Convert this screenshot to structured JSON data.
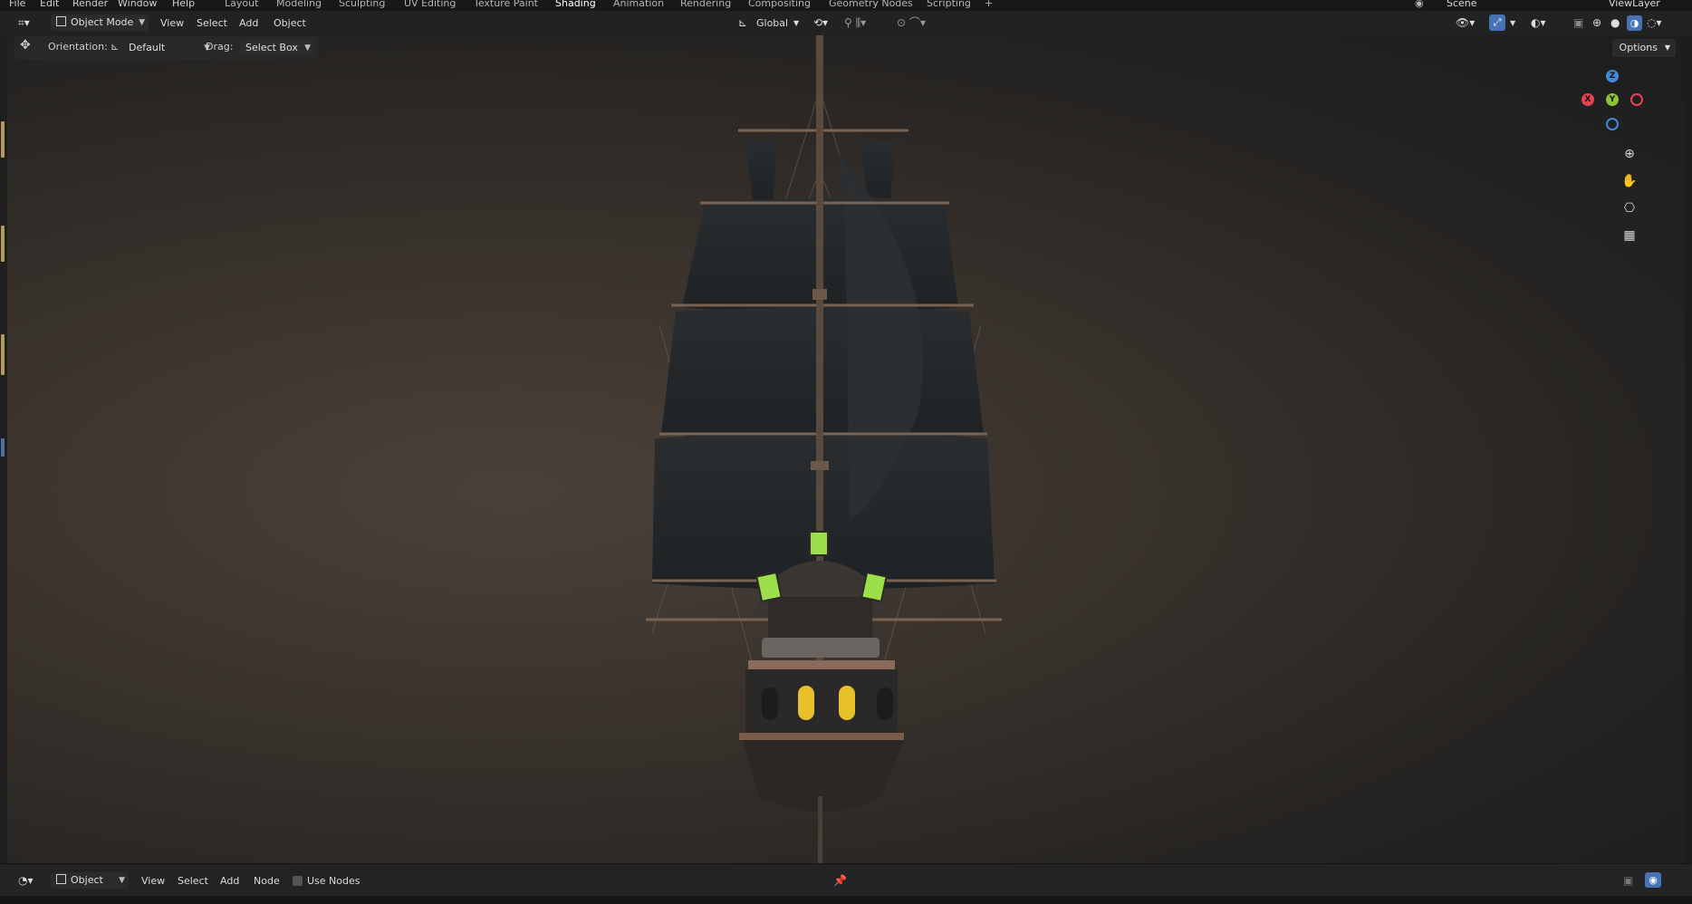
{
  "menu": {
    "file": "File",
    "edit": "Edit",
    "render": "Render",
    "window": "Window",
    "help": "Help"
  },
  "workspaces": [
    "Layout",
    "Modeling",
    "Sculpting",
    "UV Editing",
    "Texture Paint",
    "Shading",
    "Animation",
    "Rendering",
    "Compositing",
    "Geometry Nodes",
    "Scripting"
  ],
  "active_workspace": "Shading",
  "scene": {
    "name": "Scene",
    "view_layer": "ViewLayer"
  },
  "header": {
    "mode": "Object Mode",
    "view": "View",
    "select": "Select",
    "add": "Add",
    "object": "Object",
    "transform_orientation": "Global"
  },
  "tool_settings": {
    "orientation_label": "Orientation:",
    "orientation_value": "Default",
    "drag_label": "Drag:",
    "drag_value": "Select Box",
    "options": "Options"
  },
  "gizmo": {
    "x": "X",
    "y": "Y",
    "z": "Z"
  },
  "node_editor_header": {
    "mode": "Object",
    "view": "View",
    "select": "Select",
    "add": "Add",
    "node": "Node",
    "use_nodes": "Use Nodes"
  },
  "colors": {
    "x_axis": "#e5434f",
    "y_axis": "#8bc43b",
    "z_axis": "#3f8ad8",
    "active_toggle": "#4772b3",
    "lantern_green": "#9be04a",
    "window_yellow": "#e8c12a"
  },
  "icons": [
    "editor-type-icon",
    "move-icon",
    "orientation-icon",
    "pivot-icon",
    "snap-icon",
    "proportional-icon",
    "overlay-icon",
    "xray-icon",
    "wireframe-shading-icon",
    "solid-shading-icon",
    "material-shading-icon",
    "rendered-shading-icon",
    "zoom-icon",
    "hand-pan-icon",
    "camera-icon",
    "grid-icon",
    "pin-icon"
  ]
}
